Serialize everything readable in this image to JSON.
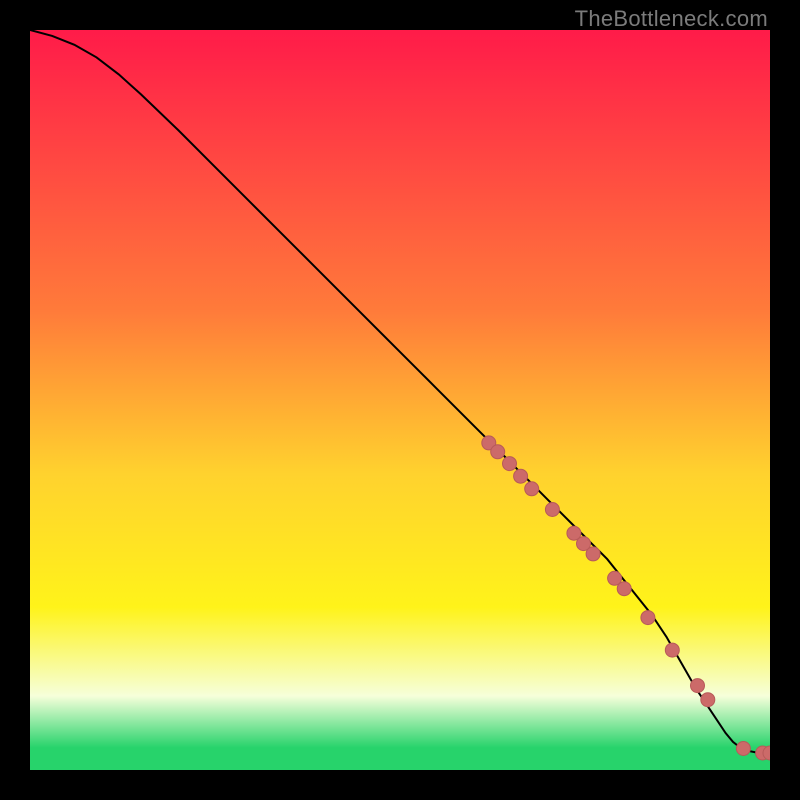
{
  "watermark": "TheBottleneck.com",
  "colors": {
    "top": "#ff1b49",
    "mid1": "#ff7b3a",
    "mid2": "#ffd22e",
    "mid3": "#fff31a",
    "pale": "#f6ffda",
    "green": "#27d36b",
    "line": "#000000",
    "marker_fill": "#cc6a69",
    "marker_stroke": "#b75a59"
  },
  "gradient_stops": [
    {
      "offset": 0,
      "key": "top"
    },
    {
      "offset": 38,
      "key": "mid1"
    },
    {
      "offset": 60,
      "key": "mid2"
    },
    {
      "offset": 78,
      "key": "mid3"
    },
    {
      "offset": 90,
      "key": "pale"
    },
    {
      "offset": 97,
      "key": "green"
    },
    {
      "offset": 100,
      "key": "green"
    }
  ],
  "chart_data": {
    "type": "line",
    "title": "",
    "xlabel": "",
    "ylabel": "",
    "xlim": [
      0,
      100
    ],
    "ylim": [
      0,
      100
    ],
    "grid": false,
    "series": [
      {
        "name": "curve",
        "x": [
          0,
          3,
          6,
          9,
          12,
          15,
          20,
          25,
          30,
          35,
          40,
          45,
          50,
          55,
          60,
          62,
          64,
          66,
          68,
          70,
          72,
          74,
          76,
          78,
          80,
          82,
          84,
          86,
          88,
          90,
          92,
          94,
          95,
          96,
          97,
          98,
          99,
          100
        ],
        "y": [
          100,
          99.2,
          98.0,
          96.3,
          94.0,
          91.3,
          86.5,
          81.5,
          76.5,
          71.5,
          66.5,
          61.5,
          56.5,
          51.5,
          46.5,
          44.5,
          42.5,
          40.5,
          38.5,
          36.5,
          34.5,
          32.5,
          30.5,
          28.5,
          26.0,
          23.5,
          21.0,
          18.0,
          14.5,
          11.0,
          8.0,
          5.0,
          3.8,
          3.0,
          2.6,
          2.4,
          2.3,
          2.3
        ]
      }
    ],
    "markers": [
      {
        "x": 62.0,
        "y": 44.2,
        "r": 7
      },
      {
        "x": 63.2,
        "y": 43.0,
        "r": 7
      },
      {
        "x": 64.8,
        "y": 41.4,
        "r": 7
      },
      {
        "x": 66.3,
        "y": 39.7,
        "r": 7
      },
      {
        "x": 67.8,
        "y": 38.0,
        "r": 7
      },
      {
        "x": 70.6,
        "y": 35.2,
        "r": 7
      },
      {
        "x": 73.5,
        "y": 32.0,
        "r": 7
      },
      {
        "x": 74.8,
        "y": 30.6,
        "r": 7
      },
      {
        "x": 76.1,
        "y": 29.2,
        "r": 7
      },
      {
        "x": 79.0,
        "y": 25.9,
        "r": 7
      },
      {
        "x": 80.3,
        "y": 24.5,
        "r": 7
      },
      {
        "x": 83.5,
        "y": 20.6,
        "r": 7
      },
      {
        "x": 86.8,
        "y": 16.2,
        "r": 7
      },
      {
        "x": 90.2,
        "y": 11.4,
        "r": 7
      },
      {
        "x": 91.6,
        "y": 9.5,
        "r": 7
      },
      {
        "x": 96.4,
        "y": 2.9,
        "r": 7
      },
      {
        "x": 99.0,
        "y": 2.3,
        "r": 7
      },
      {
        "x": 100.0,
        "y": 2.3,
        "r": 7
      }
    ]
  }
}
